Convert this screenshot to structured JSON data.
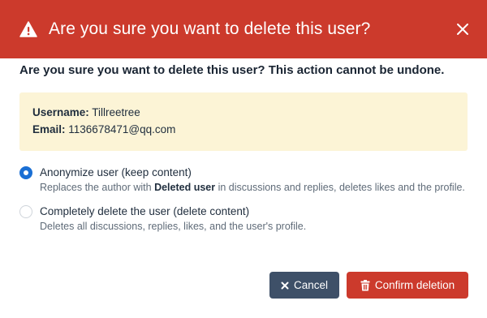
{
  "dialog": {
    "title": "Are you sure you want to delete this user?",
    "question": "Are you sure you want to delete this user? This action cannot be undone.",
    "colors": {
      "header": "#cc3a2c",
      "info_bg": "#fcf4d6",
      "radio_active": "#1a6fd4",
      "cancel": "#3e5068"
    }
  },
  "user_info": {
    "username_label": "Username:",
    "username": "Tillreetree",
    "email_label": "Email:",
    "email": "1136678471@qq.com"
  },
  "options": [
    {
      "label": "Anonymize user (keep content)",
      "checked": true,
      "desc_before": "Replaces the author with ",
      "desc_bold": "Deleted user",
      "desc_after": " in discussions and replies, deletes likes and the profile."
    },
    {
      "label": "Completely delete the user (delete content)",
      "checked": false,
      "desc": "Deletes all discussions, replies, likes, and the user's profile."
    }
  ],
  "buttons": {
    "cancel": "Cancel",
    "confirm": "Confirm deletion"
  },
  "icons": {
    "header": "warning-triangle-icon",
    "close": "close-icon",
    "cancel": "x-icon",
    "confirm": "trash-icon"
  }
}
